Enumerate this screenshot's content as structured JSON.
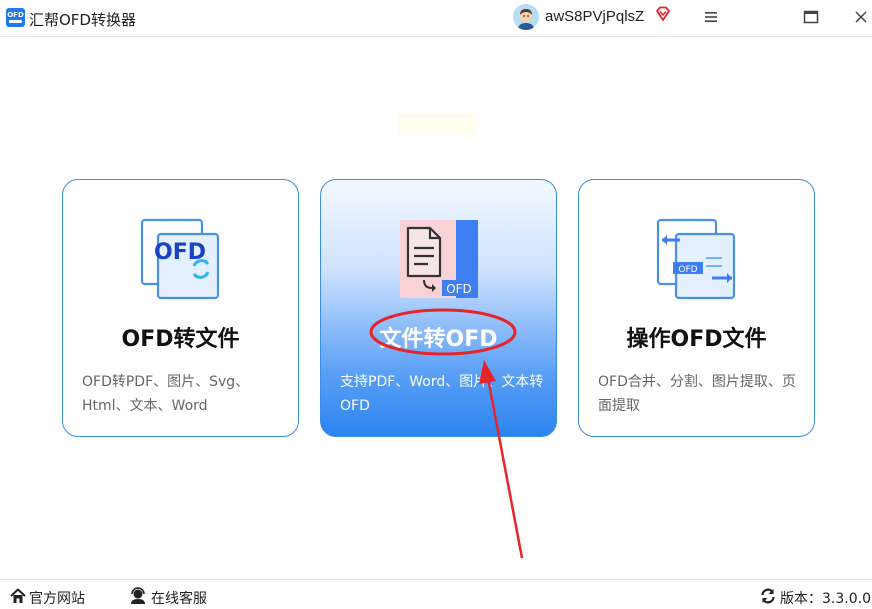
{
  "app": {
    "title": "汇帮OFD转换器",
    "logo_text": "OFD"
  },
  "user": {
    "name": "awS8PVjPqlsZ"
  },
  "colors": {
    "accent": "#1f7be8",
    "card_border": "#3a8ee6",
    "annotation": "#e5252a"
  },
  "cards": [
    {
      "title": "OFD转文件",
      "desc": "OFD转PDF、图片、Svg、Html、文本、Word",
      "icon": "ofd-to-file-icon",
      "icon_text": "OFD"
    },
    {
      "title": "文件转OFD",
      "desc": "支持PDF、Word、图片、文本转OFD",
      "icon": "file-to-ofd-icon",
      "icon_text": "OFD",
      "selected": true
    },
    {
      "title": "操作OFD文件",
      "desc": "OFD合并、分割、图片提取、页面提取",
      "icon": "ofd-operate-icon",
      "icon_text": "OFD"
    }
  ],
  "footer": {
    "website": "官方网站",
    "service": "在线客服",
    "version": "版本：3.3.0.0"
  }
}
